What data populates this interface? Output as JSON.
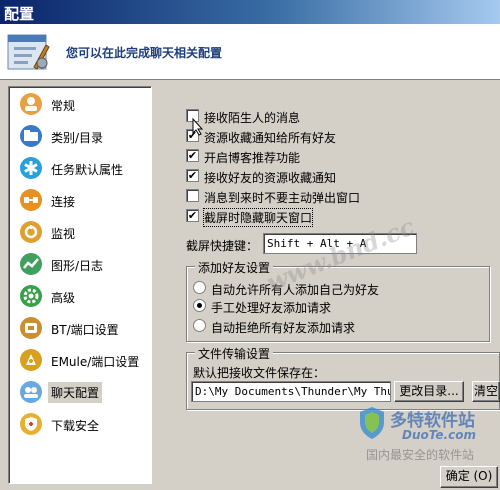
{
  "window": {
    "title": "配置"
  },
  "banner": {
    "text": "您可以在此完成聊天相关配置"
  },
  "sidebar": {
    "items": [
      {
        "label": "常规",
        "color": "#e8a040"
      },
      {
        "label": "类别/目录",
        "color": "#3a78c8"
      },
      {
        "label": "任务默认属性",
        "color": "#2aa0d8"
      },
      {
        "label": "连接",
        "color": "#e89020"
      },
      {
        "label": "监视",
        "color": "#e0a030"
      },
      {
        "label": "图形/日志",
        "color": "#40a060"
      },
      {
        "label": "高级",
        "color": "#38a048"
      },
      {
        "label": "BT/端口设置",
        "color": "#c89030"
      },
      {
        "label": "EMule/端口设置",
        "color": "#d8a020"
      },
      {
        "label": "聊天配置",
        "color": "#6aa8e0"
      },
      {
        "label": "下载安全",
        "color": "#e8b030"
      }
    ],
    "active_index": 9
  },
  "options": {
    "items": [
      {
        "label": "接收陌生人的消息",
        "checked": false
      },
      {
        "label": "资源收藏通知给所有好友",
        "checked": true
      },
      {
        "label": "开启博客推荐功能",
        "checked": true
      },
      {
        "label": "接收好友的资源收藏通知",
        "checked": true
      },
      {
        "label": "消息到来时不要主动弹出窗口",
        "checked": false
      },
      {
        "label": "截屏时隐藏聊天窗口",
        "checked": true
      }
    ]
  },
  "hotkey": {
    "label": "截屏快捷键：",
    "value": "Shift + Alt + A"
  },
  "friend_group": {
    "title": "添加好友设置",
    "options": [
      {
        "label": "自动允许所有人添加自己为好友",
        "selected": false
      },
      {
        "label": "手工处理好友添加请求",
        "selected": true
      },
      {
        "label": "自动拒绝所有好友添加请求",
        "selected": false
      }
    ]
  },
  "file_group": {
    "title": "文件传输设置",
    "path_label": "默认把接收文件保存在：",
    "path_value": "D:\\My Documents\\Thunder\\My Thunde",
    "change_button": "更改目录...",
    "clear_button": "清空"
  },
  "footer": {
    "ok_button": "确定 (O)"
  },
  "watermarks": {
    "site1": "www.bnd.cc",
    "logo_text": "多特软件站",
    "logo_url": "DuoTe.com",
    "caption": "国内最安全的软件站"
  }
}
